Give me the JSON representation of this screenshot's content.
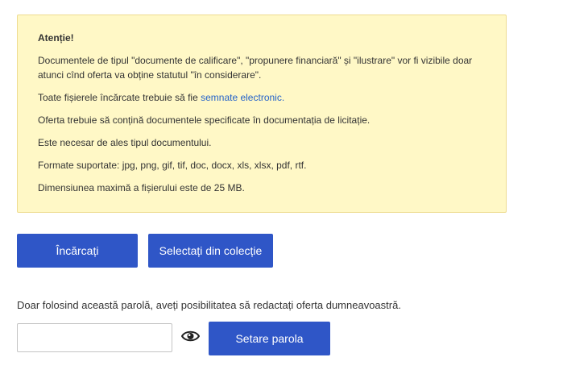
{
  "notice": {
    "title": "Atenție!",
    "line1": "Documentele de tipul \"documente de calificare\", \"propunere financiară\" și \"ilustrare\" vor fi vizibile doar atunci cînd oferta va obține statutul \"în considerare\".",
    "line2_prefix": "Toate fișierele încărcate trebuie să fie ",
    "line2_link": "semnate electronic.",
    "line3": "Oferta trebuie să conțină documentele specificate în documentația de licitație.",
    "line4": "Este necesar de ales tipul documentului.",
    "line5": "Formate suportate: jpg, png, gif, tif, doc, docx, xls, xlsx, pdf, rtf.",
    "line6": "Dimensiunea maximă a fișierului este de 25 MB."
  },
  "actions": {
    "upload_label": "Încărcați",
    "collection_label": "Selectați din colecție"
  },
  "password": {
    "hint": "Doar folosind această parolă, aveți posibilitatea să redactați oferta dumneavoastră.",
    "value": "",
    "placeholder": "",
    "toggle_icon": "eye-icon",
    "set_label": "Setare parola"
  },
  "colors": {
    "accent": "#2f56c7",
    "notice_bg": "#fff8c6",
    "notice_border": "#eedc91",
    "link": "#2563c9"
  }
}
